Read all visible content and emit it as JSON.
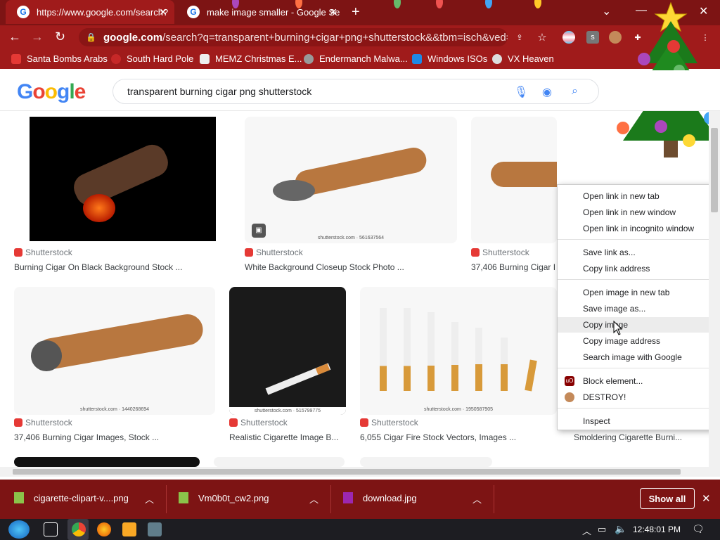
{
  "browser": {
    "tabs": [
      {
        "label": "https://www.google.com/search?",
        "favicon": "google-icon"
      },
      {
        "label": "make image smaller - Google Se",
        "favicon": "google-icon"
      }
    ],
    "new_tab": "+",
    "address": {
      "host": "google.com",
      "rest": "/search?q=transparent+burning+cigar+png+shutterstock&&tbm=isch&ved=2..."
    },
    "bookmarks": [
      "Santa Bombs Arabs",
      "South Hard Pole",
      "MEMZ Christmas E...",
      "Endermanch Malwa...",
      "Windows ISOs",
      "VX Heaven"
    ],
    "theme_color": "#a01b1b"
  },
  "google": {
    "logo": "Google",
    "query": "transparent burning cigar png shutterstock"
  },
  "results": [
    {
      "source": "Shutterstock",
      "title": "Burning Cigar On Black Background Stock ..."
    },
    {
      "source": "Shutterstock",
      "title": "White Background Closeup Stock Photo ...",
      "watermark": "shutterstock.com · 561637564"
    },
    {
      "source": "Shutterstock",
      "title": "37,406 Burning Cigar I"
    },
    {
      "source": "Shutterstock",
      "title": "37,406 Burning Cigar Images, Stock ...",
      "watermark": "shutterstock.com · 1440268694"
    },
    {
      "source": "Shutterstock",
      "title": "Realistic Cigarette Image B...",
      "watermark": "shutterstock.com · 515799775"
    },
    {
      "source": "Shutterstock",
      "title": "6,055 Cigar Fire Stock Vectors, Images ...",
      "watermark": "shutterstock.com · 1950587905"
    },
    {
      "source": "",
      "title": "Smoldering Cigarette Burni..."
    }
  ],
  "context_menu": [
    "Open link in new tab",
    "Open link in new window",
    "Open link in incognito window",
    "Save link as...",
    "Copy link address",
    "Open image in new tab",
    "Save image as...",
    "Copy image",
    "Copy image address",
    "Search image with Google",
    "Block element...",
    "DESTROY!",
    "Inspect"
  ],
  "downloads": {
    "items": [
      "cigarette-clipart-v....png",
      "Vm0b0t_cw2.png",
      "download.jpg"
    ],
    "show_all": "Show all"
  },
  "taskbar": {
    "clock": "12:48:01 PM"
  }
}
